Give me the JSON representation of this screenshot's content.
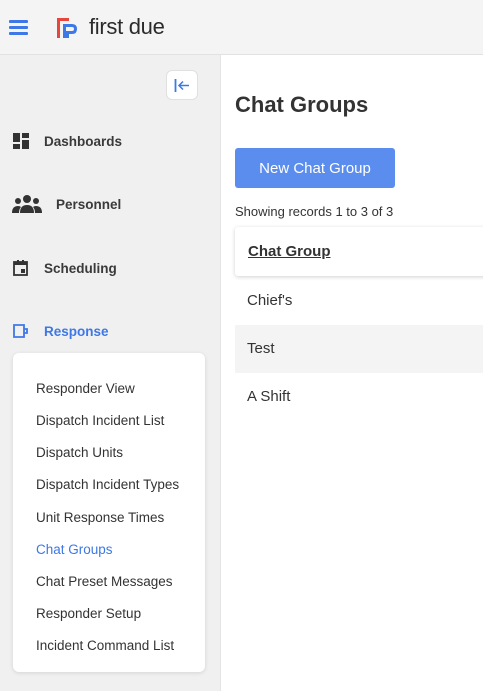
{
  "app": {
    "logo_text": "first due",
    "brand_colors": {
      "primary": "#3d78e6",
      "logo_red": "#e8453c",
      "logo_blue": "#3d78e6"
    }
  },
  "sidebar": {
    "nav": [
      {
        "label": "Dashboards",
        "icon": "dashboard-icon"
      },
      {
        "label": "Personnel",
        "icon": "people-icon"
      },
      {
        "label": "Scheduling",
        "icon": "calendar-icon"
      },
      {
        "label": "Response",
        "icon": "response-icon",
        "active": true
      }
    ],
    "submenu": [
      "Responder View",
      "Dispatch Incident List",
      "Dispatch Units",
      "Dispatch Incident Types",
      "Unit Response Times",
      "Chat Groups",
      "Chat Preset Messages",
      "Responder Setup",
      "Incident Command List"
    ],
    "active_submenu": "Chat Groups"
  },
  "main": {
    "title": "Chat Groups",
    "new_button": "New Chat Group",
    "records_text": "Showing records 1 to 3 of 3",
    "table": {
      "column": "Chat Group",
      "rows": [
        "Chief's",
        "Test",
        "A Shift"
      ]
    }
  }
}
